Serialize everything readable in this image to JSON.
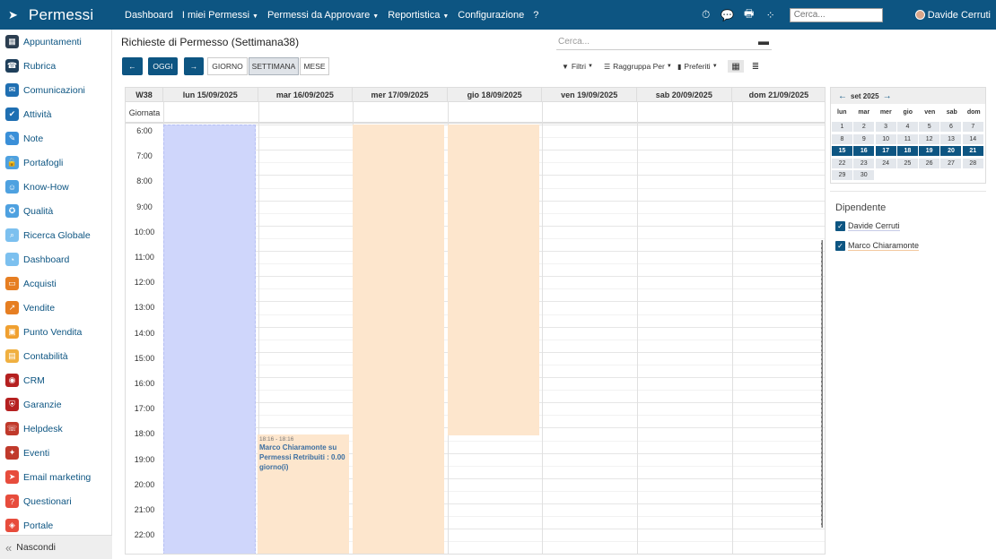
{
  "app": {
    "name": "Permessi"
  },
  "topnav": [
    {
      "label": "Dashboard",
      "dropdown": false
    },
    {
      "label": "I miei Permessi",
      "dropdown": true
    },
    {
      "label": "Permessi da Approvare",
      "dropdown": true
    },
    {
      "label": "Reportistica",
      "dropdown": true
    },
    {
      "label": "Configurazione",
      "dropdown": false
    },
    {
      "label": "?",
      "dropdown": false
    }
  ],
  "topbar": {
    "search_placeholder": "Cerca...",
    "user": "Davide Cerruti"
  },
  "sidebar": {
    "items": [
      {
        "label": "Appuntamenti",
        "color": "#2c3e50",
        "icon": "calendar-icon"
      },
      {
        "label": "Rubrica",
        "color": "#1f3f5b",
        "icon": "contacts-icon"
      },
      {
        "label": "Comunicazioni",
        "color": "#1f6fb2",
        "icon": "chat-icon"
      },
      {
        "label": "Attività",
        "color": "#1f6fb2",
        "icon": "checkbox-icon"
      },
      {
        "label": "Note",
        "color": "#3a8fd8",
        "icon": "note-icon"
      },
      {
        "label": "Portafogli",
        "color": "#4ea1e0",
        "icon": "lock-icon"
      },
      {
        "label": "Know-How",
        "color": "#4ea1e0",
        "icon": "brain-icon"
      },
      {
        "label": "Qualità",
        "color": "#4ea1e0",
        "icon": "quality-icon"
      },
      {
        "label": "Ricerca Globale",
        "color": "#7cc0ef",
        "icon": "search-icon"
      },
      {
        "label": "Dashboard",
        "color": "#7cc0ef",
        "icon": "dashboard-icon"
      },
      {
        "label": "Acquisti",
        "color": "#e67e22",
        "icon": "cart-icon"
      },
      {
        "label": "Vendite",
        "color": "#e67e22",
        "icon": "chart-icon"
      },
      {
        "label": "Punto Vendita",
        "color": "#f0a030",
        "icon": "store-icon"
      },
      {
        "label": "Contabilità",
        "color": "#f0b040",
        "icon": "ledger-icon"
      },
      {
        "label": "CRM",
        "color": "#b52020",
        "icon": "crm-icon"
      },
      {
        "label": "Garanzie",
        "color": "#b52020",
        "icon": "shield-icon"
      },
      {
        "label": "Helpdesk",
        "color": "#c0392b",
        "icon": "headset-icon"
      },
      {
        "label": "Eventi",
        "color": "#c0392b",
        "icon": "ticket-icon"
      },
      {
        "label": "Email marketing",
        "color": "#e74c3c",
        "icon": "send-icon"
      },
      {
        "label": "Questionari",
        "color": "#e74c3c",
        "icon": "survey-icon"
      },
      {
        "label": "Portale",
        "color": "#e74c3c",
        "icon": "portal-icon"
      }
    ],
    "hide_label": "Nascondi"
  },
  "control": {
    "title": "Richieste di Permesso (Settimana38)",
    "search_placeholder": "Cerca...",
    "today": "OGGI",
    "views": [
      "GIORNO",
      "SETTIMANA",
      "MESE"
    ],
    "active_view": "SETTIMANA",
    "filters_label": "Filtri",
    "group_label": "Raggruppa Per",
    "favorites_label": "Preferiti"
  },
  "calendar": {
    "week_label": "W38",
    "allday_label": "Giornata",
    "days": [
      "lun 15/09/2025",
      "mar 16/09/2025",
      "mer 17/09/2025",
      "gio 18/09/2025",
      "ven 19/09/2025",
      "sab 20/09/2025",
      "dom 21/09/2025"
    ],
    "hours": [
      "6:00",
      "7:00",
      "8:00",
      "9:00",
      "10:00",
      "11:00",
      "12:00",
      "13:00",
      "14:00",
      "15:00",
      "16:00",
      "17:00",
      "18:00",
      "19:00",
      "20:00",
      "21:00",
      "22:00"
    ],
    "event": {
      "time": "18:16 - 18:16",
      "title": "Marco Chiaramonte su Permessi Retribuiti : 0.00 giorno(i)"
    }
  },
  "minical": {
    "month": "set 2025",
    "weekdays": [
      "lun",
      "mar",
      "mer",
      "gio",
      "ven",
      "sab",
      "dom"
    ],
    "weeks": [
      [
        "1",
        "2",
        "3",
        "4",
        "5",
        "6",
        "7"
      ],
      [
        "8",
        "9",
        "10",
        "11",
        "12",
        "13",
        "14"
      ],
      [
        "15",
        "16",
        "17",
        "18",
        "19",
        "20",
        "21"
      ],
      [
        "22",
        "23",
        "24",
        "25",
        "26",
        "27",
        "28"
      ],
      [
        "29",
        "30",
        "",
        "",
        "",
        "",
        ""
      ]
    ],
    "selected_week": 2
  },
  "employee_filter": {
    "title": "Dipendente",
    "items": [
      "Davide Cerruti",
      "Marco Chiaramonte"
    ]
  }
}
